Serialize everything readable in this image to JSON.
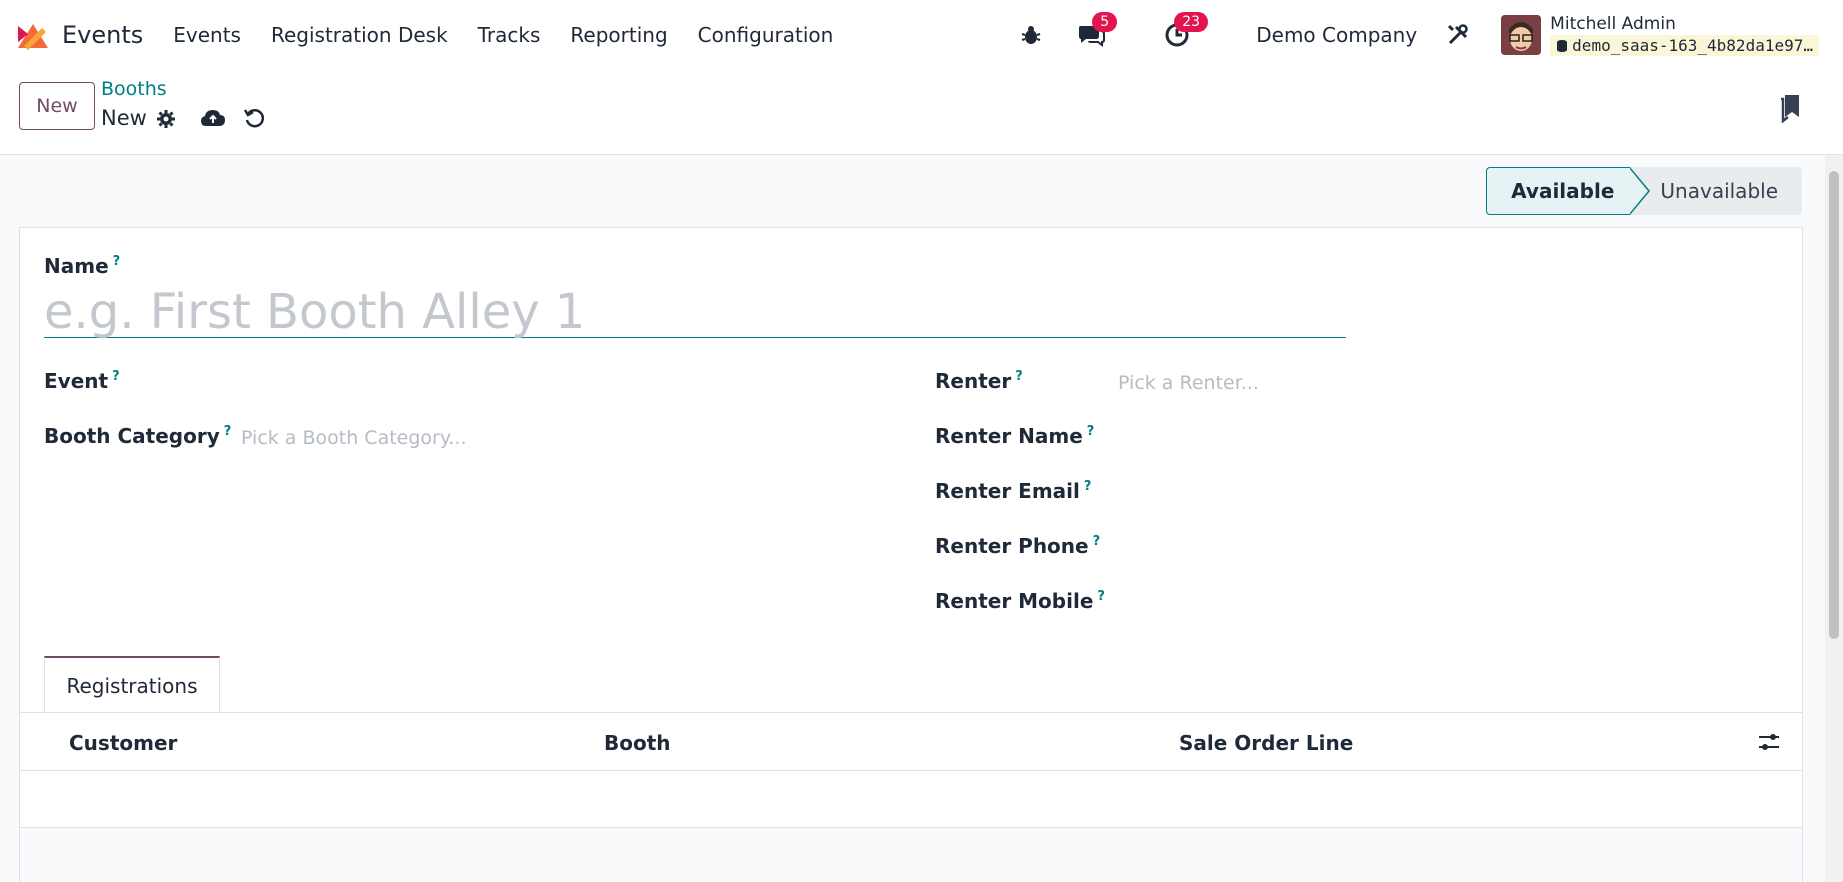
{
  "navbar": {
    "app_name": "Events",
    "menu": [
      "Events",
      "Registration Desk",
      "Tracks",
      "Reporting",
      "Configuration"
    ],
    "messages_count": "5",
    "activities_count": "23",
    "company": "Demo Company",
    "user_name": "Mitchell Admin",
    "database": "demo_saas-163_4b82da1e97…"
  },
  "control_panel": {
    "new_label": "New",
    "breadcrumb": "Booths",
    "record_name": "New"
  },
  "statusbar": {
    "stages": [
      "Available",
      "Unavailable"
    ],
    "active": "Available"
  },
  "form": {
    "name_label": "Name",
    "name_placeholder": "e.g. First Booth Alley 1",
    "event_label": "Event",
    "booth_category_label": "Booth Category",
    "booth_category_placeholder": "Pick a Booth Category...",
    "renter_label": "Renter",
    "renter_placeholder": "Pick a Renter...",
    "renter_name_label": "Renter Name",
    "renter_email_label": "Renter Email",
    "renter_phone_label": "Renter Phone",
    "renter_mobile_label": "Renter Mobile",
    "help_mark": "?"
  },
  "notebook": {
    "tab_label": "Registrations",
    "columns": [
      "Customer",
      "Booth",
      "Sale Order Line"
    ]
  },
  "colors": {
    "brand": "#714b67",
    "accent": "#017e84",
    "badge": "#e3154e"
  }
}
